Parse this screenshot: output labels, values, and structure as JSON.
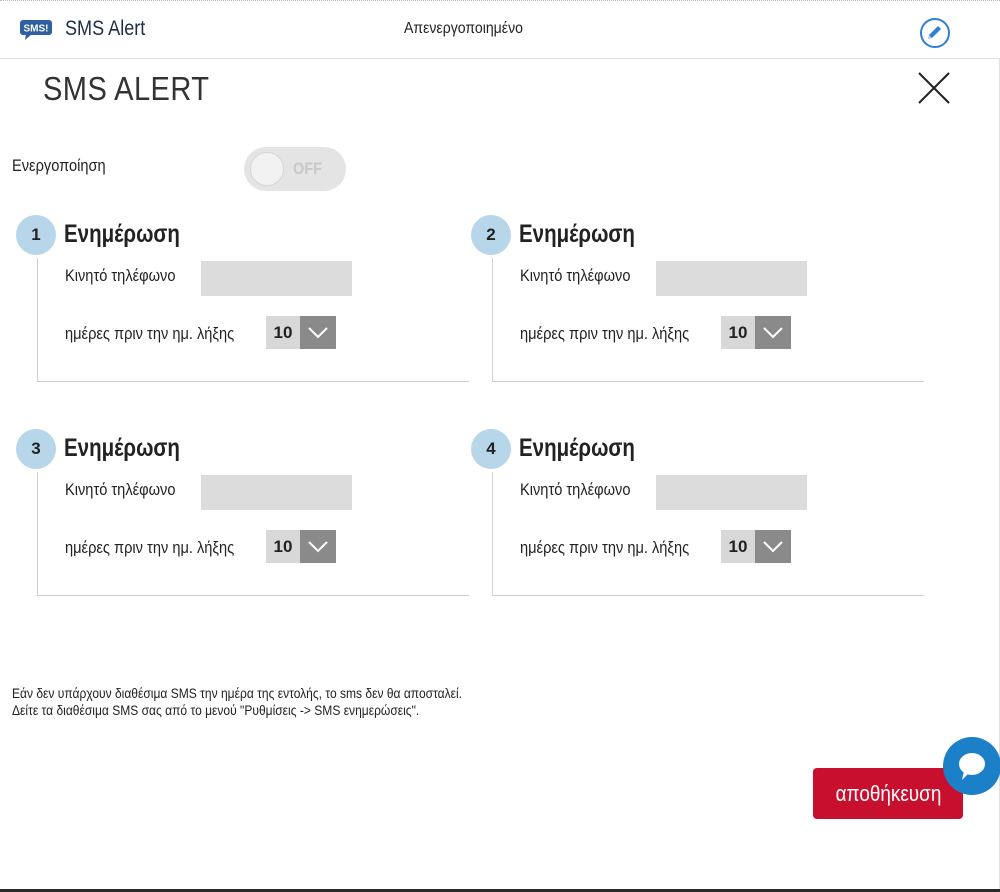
{
  "header": {
    "app_title": "SMS Alert",
    "logo_text": "SMS!",
    "status": "Απενεργοποιημένο",
    "edit_icon": "pencil-icon"
  },
  "panel": {
    "title": "SMS ALERT",
    "close_icon": "close-icon",
    "activate_label": "Ενεργοποίηση",
    "toggle": {
      "state": "OFF",
      "enabled": false
    }
  },
  "notifications": [
    {
      "number": "1",
      "heading": "Ενημέρωση",
      "phone_label": "Κινητό τηλέφωνο",
      "phone_value": "",
      "days_label": "ημέρες πριν την ημ. λήξης",
      "days_value": "10"
    },
    {
      "number": "2",
      "heading": "Ενημέρωση",
      "phone_label": "Κινητό τηλέφωνο",
      "phone_value": "",
      "days_label": "ημέρες πριν την ημ. λήξης",
      "days_value": "10"
    },
    {
      "number": "3",
      "heading": "Ενημέρωση",
      "phone_label": "Κινητό τηλέφωνο",
      "phone_value": "",
      "days_label": "ημέρες πριν την ημ. λήξης",
      "days_value": "10"
    },
    {
      "number": "4",
      "heading": "Ενημέρωση",
      "phone_label": "Κινητό τηλέφωνο",
      "phone_value": "",
      "days_label": "ημέρες πριν την ημ. λήξης",
      "days_value": "10"
    }
  ],
  "footnote": {
    "line1": "Εάν  δεν υπάρχουν διαθέσιμα SMS την ημέρα της εντολής, το sms δεν θα αποσταλεί.",
    "line2": "Δείτε τα διαθέσιμα SMS σας από το μενού \"Ρυθμίσεις -> SMS ενημερώσεις\"."
  },
  "save_label": "αποθήκευση",
  "colors": {
    "accent": "#2f7ed8",
    "save": "#c8102e",
    "badge": "#b7d6e9",
    "chat": "#1b80c8"
  },
  "chat_icon": "chat-bubble-icon"
}
